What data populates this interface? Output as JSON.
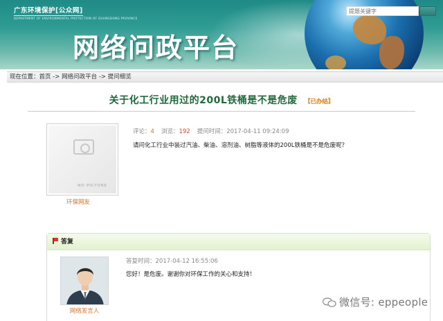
{
  "banner": {
    "logo_cn": "广东环境保护[公众网]",
    "logo_en": "DEPARTMENT OF ENVIRONMENTAL PROTECTION OF GUANGDONG PROVINCE",
    "title": "网络问政平台",
    "search_placeholder": "提题关键字"
  },
  "breadcrumb": {
    "prefix": "现在位置：",
    "items": [
      "首页",
      "网络问政平台",
      "提问细览"
    ],
    "separator": " -> "
  },
  "question": {
    "title": "关于化工行业用过的200L铁桶是不是危废",
    "status": "【已办结】",
    "avatar_caption": "NO PICTURE",
    "user_name": "环保网友",
    "comments_label": "评论：",
    "comments_count": "4",
    "views_label": "浏览：",
    "views_count": "192",
    "time_label": "提问时间：",
    "time": "2017-04-11 09:24:09",
    "text": "请问化工行业中装过汽油、柴油、溶剂油、树脂等液体的200L铁桶是不是危废呢？"
  },
  "reply": {
    "header": "答复",
    "time_label": "答复时间：",
    "time": "2017-04-12 16:55:06",
    "text": "您好！是危废。谢谢你对环保工作的关心和支持！",
    "responder": "网络发言人"
  },
  "watermark": "微信号: eppeople",
  "colors": {
    "banner": "#2f9c93",
    "title_green": "#1f6a3a",
    "status_orange": "#e07a10",
    "name_orange": "#d9762b"
  }
}
